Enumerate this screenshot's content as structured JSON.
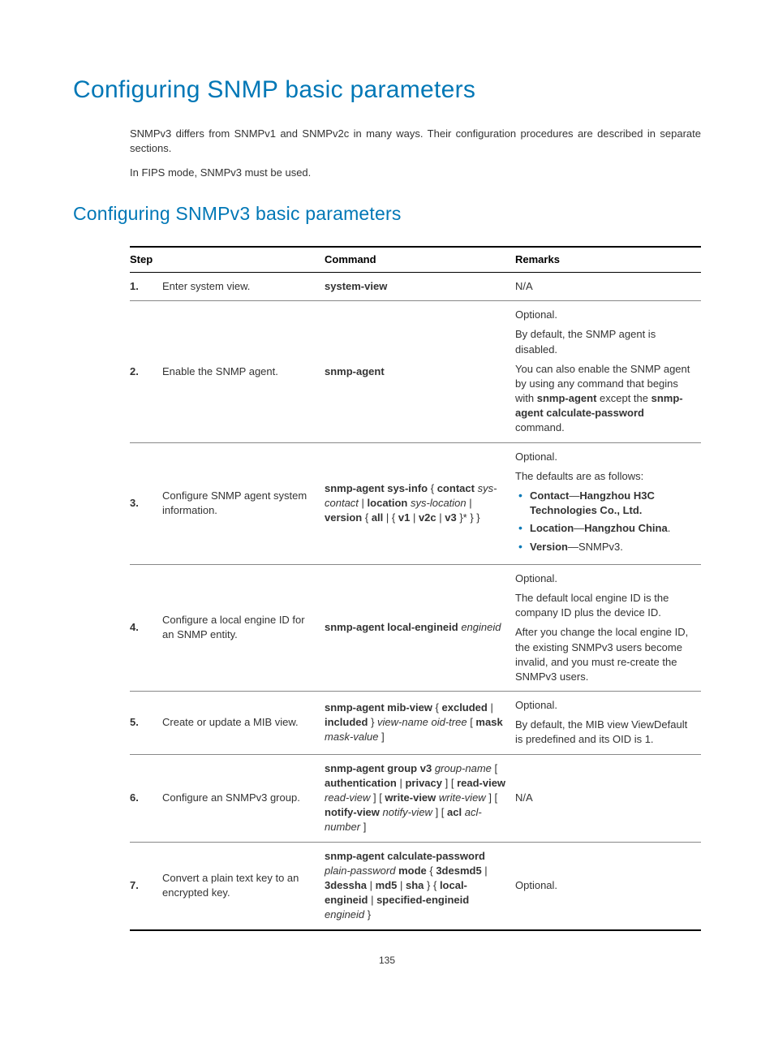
{
  "h1": "Configuring SNMP basic parameters",
  "intro1": "SNMPv3 differs from SNMPv1 and SNMPv2c in many ways. Their configuration procedures are described in separate sections.",
  "intro2": "In FIPS mode, SNMPv3 must be used.",
  "h2": "Configuring SNMPv3 basic parameters",
  "headers": {
    "step": "Step",
    "command": "Command",
    "remarks": "Remarks"
  },
  "rows": [
    {
      "num": "1.",
      "step": "Enter system view.",
      "cmd_html": "<span class='b'>system-view</span>",
      "rem_html": "N/A"
    },
    {
      "num": "2.",
      "step": "Enable the SNMP agent.",
      "cmd_html": "<span class='b'>snmp-agent</span>",
      "rem_html": "<div class='remark-block'><p>Optional.</p><p>By default, the SNMP agent is disabled.</p><p>You can also enable the SNMP agent by using any command that begins with <span class='b'>snmp-agent</span> except the <span class='b'>snmp-agent calculate-password</span> command.</p></div>"
    },
    {
      "num": "3.",
      "step": "Configure SNMP agent system information.",
      "cmd_html": "<span class='b'>snmp-agent sys-info</span> { <span class='b'>contact</span> <span class='i'>sys-contact</span> | <span class='b'>location</span> <span class='i'>sys-location</span> | <span class='b'>version</span> { <span class='b'>all</span> | { <span class='b'>v1</span> | <span class='b'>v2c</span> | <span class='b'>v3</span> }* } }",
      "rem_html": "<div class='remark-block'><p>Optional.</p><p>The defaults are as follows:</p><ul class='bullets'><li><span class='b'>Contact</span>—<span class='b'>Hangzhou H3C Technologies Co., Ltd.</span></li><li><span class='b'>Location</span>—<span class='b'>Hangzhou China</span>.</li><li><span class='b'>Version</span>—SNMPv3.</li></ul></div>"
    },
    {
      "num": "4.",
      "step": "Configure a local engine ID for an SNMP entity.",
      "cmd_html": "<span class='b'>snmp-agent local-engineid</span> <span class='i'>engineid</span>",
      "rem_html": "<div class='remark-block'><p>Optional.</p><p>The default local engine ID is the company ID plus the device ID.</p><p>After you change the local engine ID, the existing SNMPv3 users become invalid, and you must re-create the SNMPv3 users.</p></div>"
    },
    {
      "num": "5.",
      "step": "Create or update a MIB view.",
      "cmd_html": "<span class='b'>snmp-agent mib-view</span> { <span class='b'>excluded</span> | <span class='b'>included</span> } <span class='i'>view-name oid-tree</span> [ <span class='b'>mask</span> <span class='i'>mask-value</span> ]",
      "rem_html": "<div class='remark-block'><p>Optional.</p><p>By default, the MIB view ViewDefault is predefined and its OID is 1.</p></div>"
    },
    {
      "num": "6.",
      "step": "Configure an SNMPv3 group.",
      "cmd_html": "<span class='b'>snmp-agent group v3</span> <span class='i'>group-name</span> [ <span class='b'>authentication</span> | <span class='b'>privacy</span> ] [ <span class='b'>read-view</span> <span class='i'>read-view</span> ] [ <span class='b'>write-view</span> <span class='i'>write-view</span> ] [ <span class='b'>notify-view</span> <span class='i'>notify-view</span> ] [ <span class='b'>acl</span> <span class='i'>acl-number</span> ]",
      "rem_html": "N/A"
    },
    {
      "num": "7.",
      "step": "Convert a plain text key to an encrypted key.",
      "cmd_html": "<span class='b'>snmp-agent calculate-password</span> <span class='i'>plain-password</span> <span class='b'>mode</span> { <span class='b'>3desmd5</span> | <span class='b'>3dessha</span> | <span class='b'>md5</span> | <span class='b'>sha</span> } { <span class='b'>local-engineid</span> | <span class='b'>specified-engineid</span> <span class='i'>engineid</span> }",
      "rem_html": "Optional."
    }
  ],
  "page_num": "135"
}
